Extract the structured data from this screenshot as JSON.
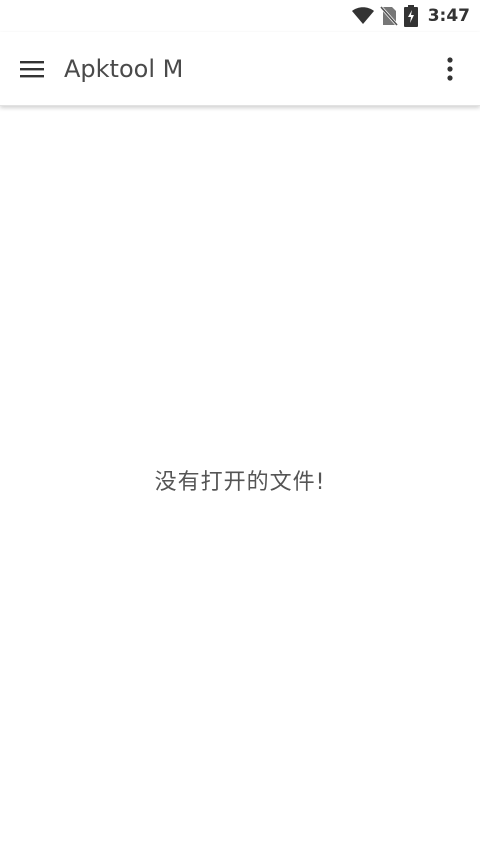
{
  "status_bar": {
    "time": "3:47",
    "icons": [
      "wifi-icon",
      "no-sim-icon",
      "battery-charging-icon"
    ]
  },
  "app_bar": {
    "title": "Apktool M",
    "menu_icon": "hamburger-menu-icon",
    "overflow_icon": "more-vert-icon"
  },
  "content": {
    "empty_message": "没有打开的文件!"
  }
}
